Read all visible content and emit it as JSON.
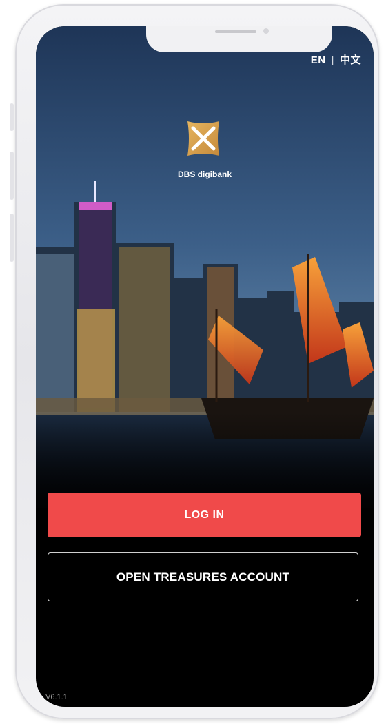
{
  "language": {
    "en": "EN",
    "separator": "|",
    "zh": "中文"
  },
  "brand": {
    "name": "DBS digibank"
  },
  "actions": {
    "login_label": "LOG IN",
    "open_account_label": "OPEN TREASURES ACCOUNT"
  },
  "footer": {
    "version": "V6.1.1"
  },
  "colors": {
    "login_button": "#f04a4a",
    "logo_gold": "#d9a24e",
    "sky_top": "#1e3557",
    "sky_bottom": "#4a6f96"
  }
}
